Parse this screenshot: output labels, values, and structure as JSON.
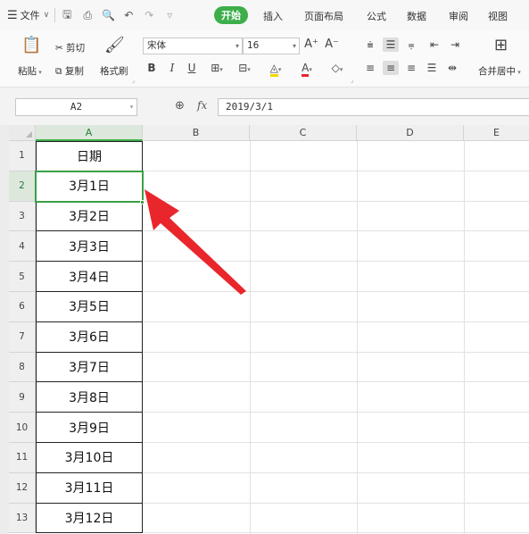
{
  "menubar": {
    "file_label": "文件",
    "tabs": [
      "开始",
      "插入",
      "页面布局",
      "公式",
      "数据",
      "审阅",
      "视图"
    ],
    "active_tab": "开始"
  },
  "ribbon": {
    "paste_label": "粘贴",
    "cut_label": "剪切",
    "copy_label": "复制",
    "format_painter_label": "格式刷",
    "font_name": "宋体",
    "font_size": "16",
    "bold": "B",
    "italic": "I",
    "underline": "U",
    "font_color_glyph": "A",
    "grow_font": "A⁺",
    "shrink_font": "A⁻",
    "merge_center_label": "合并居中"
  },
  "formula_bar": {
    "name_box": "A2",
    "fx_label": "fx",
    "formula_value": "2019/3/1"
  },
  "sheet": {
    "columns": [
      "A",
      "B",
      "C",
      "D",
      "E"
    ],
    "selected_column": "A",
    "selected_row": "2",
    "rows": [
      {
        "num": "1",
        "a": "日期"
      },
      {
        "num": "2",
        "a": "3月1日"
      },
      {
        "num": "3",
        "a": "3月2日"
      },
      {
        "num": "4",
        "a": "3月3日"
      },
      {
        "num": "5",
        "a": "3月4日"
      },
      {
        "num": "6",
        "a": "3月5日"
      },
      {
        "num": "7",
        "a": "3月6日"
      },
      {
        "num": "8",
        "a": "3月7日"
      },
      {
        "num": "9",
        "a": "3月8日"
      },
      {
        "num": "10",
        "a": "3月9日"
      },
      {
        "num": "11",
        "a": "3月10日"
      },
      {
        "num": "12",
        "a": "3月11日"
      },
      {
        "num": "13",
        "a": "3月12日"
      }
    ]
  },
  "colors": {
    "accent_green": "#3dae4a",
    "annotation_arrow": "#e8262b"
  }
}
